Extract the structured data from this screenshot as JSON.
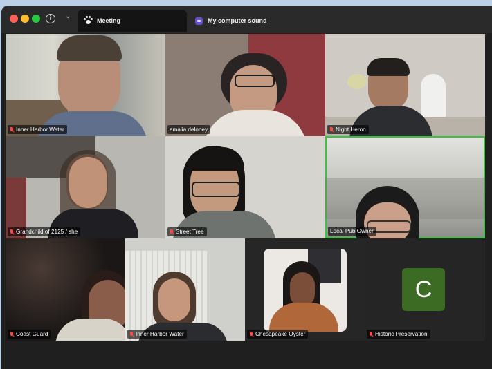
{
  "window": {
    "info_icon_glyph": "i",
    "chevron_glyph": "⌄",
    "tabs": [
      {
        "label": "Meeting",
        "icon": "paw-icon"
      },
      {
        "label": "My computer sound",
        "icon": "sound-app-icon"
      }
    ]
  },
  "participants": [
    {
      "name": "Inner Harbor Water",
      "muted": true
    },
    {
      "name": "amalia deloney",
      "muted": false
    },
    {
      "name": "Night Heron",
      "muted": true
    },
    {
      "name": "Grandchild of 2125 / she",
      "muted": true
    },
    {
      "name": "Street Tree",
      "muted": true
    },
    {
      "name": "Local Pub Owner",
      "muted": false,
      "active_speaker": true
    },
    {
      "name": "Coast Guard",
      "muted": true
    },
    {
      "name": "Inner Harbor Water",
      "muted": true
    },
    {
      "name": "Chesapeake Oyster",
      "muted": true
    },
    {
      "name": "Historic Preservation",
      "muted": true,
      "avatar_letter": "C"
    }
  ],
  "colors": {
    "active_border": "#38c23d",
    "mute": "#ff4747",
    "avatar_bg": "#3c6b23"
  }
}
